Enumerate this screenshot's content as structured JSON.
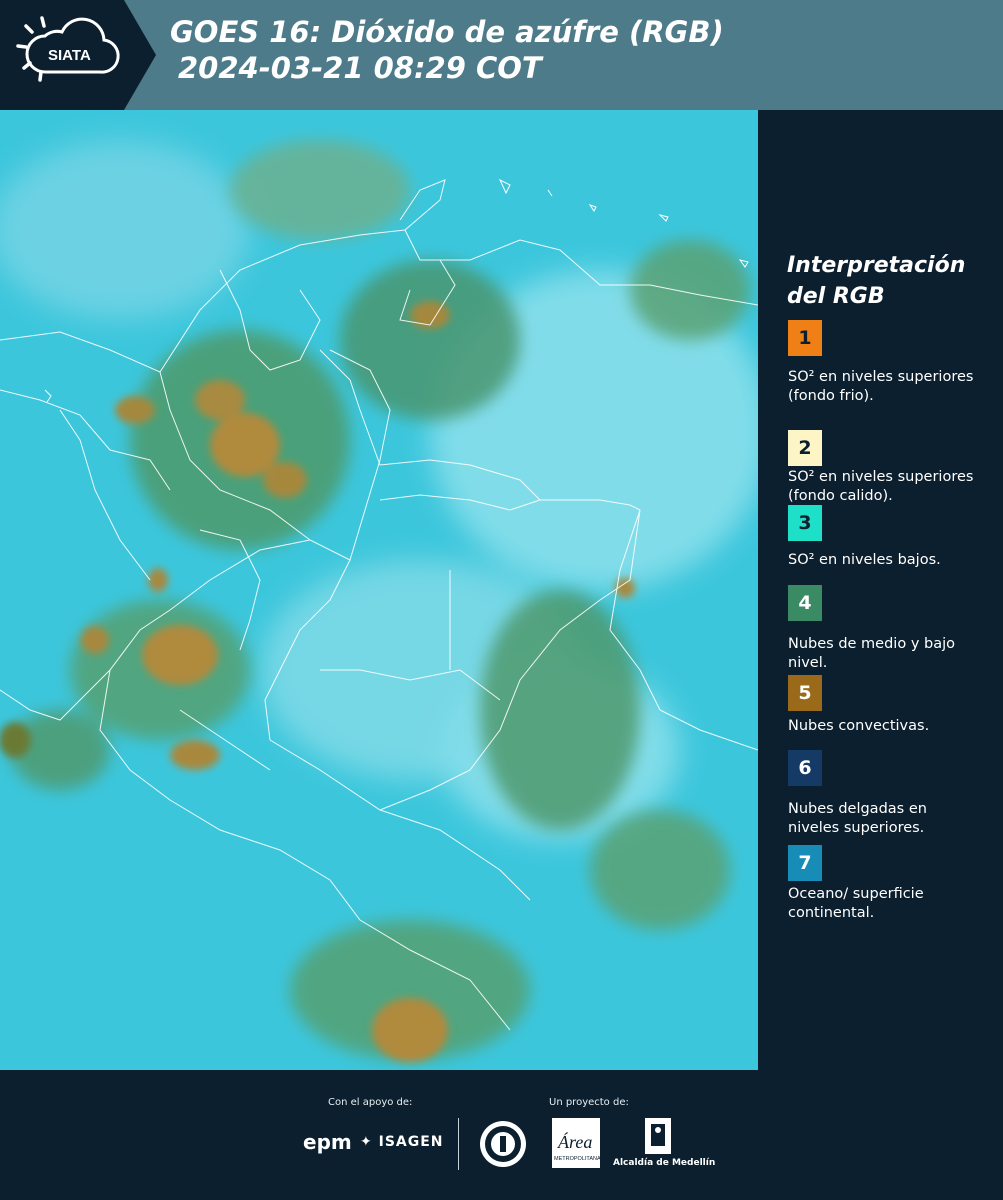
{
  "header": {
    "logo_text": "SIATA",
    "title_line1": "GOES 16: Dióxido de azúfre (RGB)",
    "title_line2": "2024-03-21 08:29 COT"
  },
  "map": {
    "icon": "satellite-map"
  },
  "legend": {
    "title_line1": "Interpretación",
    "title_line2": "del RGB",
    "items": [
      {
        "number": "1",
        "color": "#f07f16",
        "text_color": "#0c1f2e",
        "label": "SO² en niveles superiores (fondo frio)."
      },
      {
        "number": "2",
        "color": "#fdf5c6",
        "text_color": "#0c1f2e",
        "label": "SO² en niveles superiores (fondo calido)."
      },
      {
        "number": "3",
        "color": "#1ee0c8",
        "text_color": "#0c1f2e",
        "label": "SO² en niveles bajos."
      },
      {
        "number": "4",
        "color": "#3a8a64",
        "text_color": "#ffffff",
        "label": "Nubes de medio y bajo nivel."
      },
      {
        "number": "5",
        "color": "#9a6a1a",
        "text_color": "#ffffff",
        "label": "Nubes convectivas."
      },
      {
        "number": "6",
        "color": "#163a66",
        "text_color": "#ffffff",
        "label": "Nubes delgadas en niveles superiores."
      },
      {
        "number": "7",
        "color": "#168cb7",
        "text_color": "#ffffff",
        "label": "Oceano/ superficie continental."
      }
    ]
  },
  "footer": {
    "support_label": "Con el apoyo de:",
    "project_label": "Un proyecto de:",
    "epm": "epm",
    "isagen": "ISAGEN",
    "area_text": "Área",
    "area_subtext": "METROPOLITANA",
    "alcaldia": "Alcaldía de Medellín"
  }
}
